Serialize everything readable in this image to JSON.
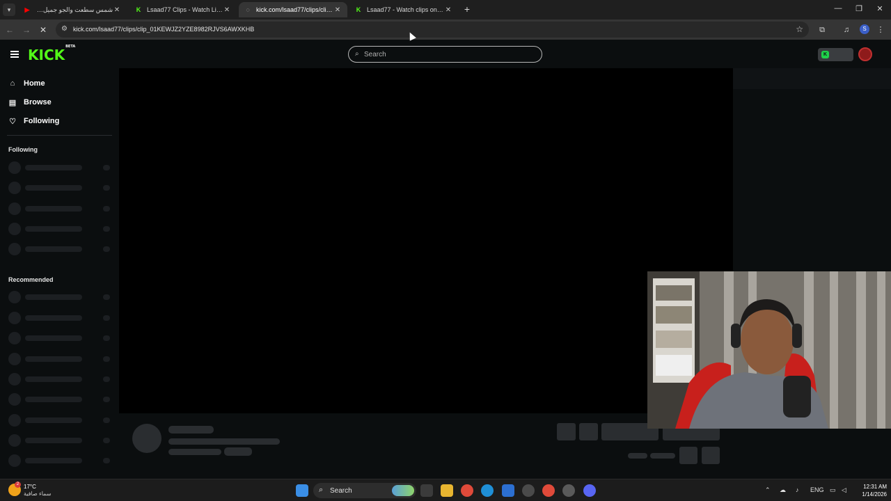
{
  "browser": {
    "tabs": [
      {
        "title": "شمس سطعت والجو جميل هنا ال",
        "favicon": "youtube-icon",
        "color": "#ff0000",
        "active": false
      },
      {
        "title": "Lsaad77 Clips - Watch Live on K",
        "favicon": "kick-icon",
        "color": "#53fc18",
        "active": false
      },
      {
        "title": "kick.com/lsaad77/clips/clip_01K",
        "favicon": "loading-icon",
        "color": "#c7c7c7",
        "active": true
      },
      {
        "title": "Lsaad77 - Watch clips on Kick",
        "favicon": "kick-icon",
        "color": "#53fc18",
        "active": false
      }
    ],
    "url": "kick.com/lsaad77/clips/clip_01KEWJZ2YZE8982RJVS6AWXKHB",
    "profile_initial": "S"
  },
  "kick": {
    "logo": "KICK",
    "logo_badge": "BETA",
    "search_placeholder": "Search",
    "nav": [
      {
        "label": "Home",
        "icon": "home-icon"
      },
      {
        "label": "Browse",
        "icon": "browse-icon"
      },
      {
        "label": "Following",
        "icon": "heart-icon"
      }
    ],
    "following_heading": "Following",
    "recommended_heading": "Recommended",
    "accent": "#53fc18"
  },
  "taskbar": {
    "weather_badge": "2",
    "temperature": "17°C",
    "condition": "سماء صافية",
    "search_placeholder": "Search",
    "language": "ENG",
    "time": "12:31 AM",
    "date": "1/14/2026"
  }
}
